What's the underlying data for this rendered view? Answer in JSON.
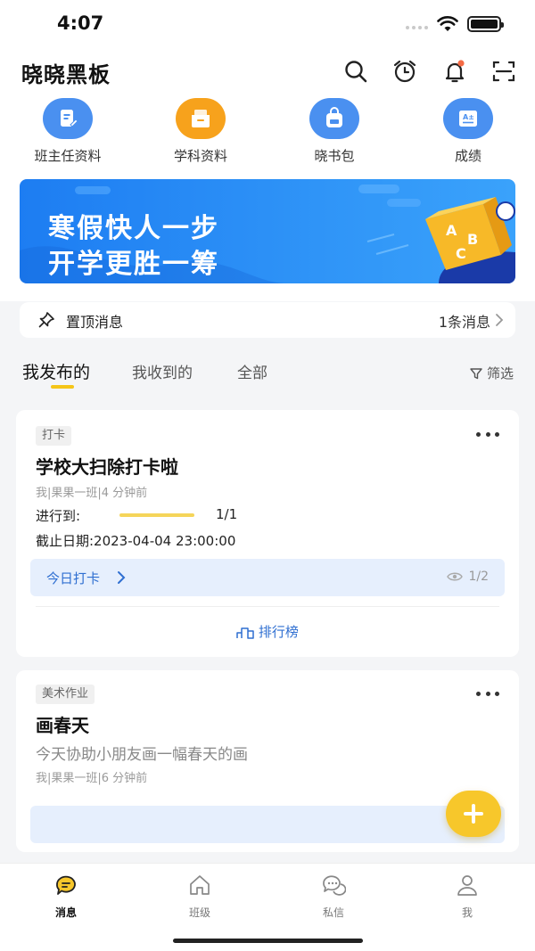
{
  "status_bar": {
    "time": "4:07"
  },
  "header": {
    "title": "晓晓黑板",
    "icons": [
      "search-icon",
      "alarm-clock-icon",
      "bell-icon",
      "scan-icon"
    ]
  },
  "quick_entries": [
    {
      "label": "班主任资料",
      "icon": "document-icon",
      "color": "#4a90f0"
    },
    {
      "label": "学科资料",
      "icon": "folder-icon",
      "color": "#f7a21c"
    },
    {
      "label": "晓书包",
      "icon": "backpack-icon",
      "color": "#4a90f0"
    },
    {
      "label": "成绩",
      "icon": "grade-icon",
      "color": "#4a90f0"
    }
  ],
  "banner": {
    "line1": "寒假快人一步",
    "line2": "开学更胜一筹",
    "cube_letters": [
      "A",
      "B",
      "C"
    ]
  },
  "pinned": {
    "label": "置顶消息",
    "count": "1条消息"
  },
  "tabs": {
    "items": [
      "我发布的",
      "我收到的",
      "全部"
    ],
    "active": 0,
    "filter": "筛选"
  },
  "cards": [
    {
      "tag": "打卡",
      "title": "学校大扫除打卡啦",
      "meta": "我|果果一班|4 分钟前",
      "progress_label": "进行到:",
      "progress": 1.0,
      "progress_text": "1/1",
      "deadline": "截止日期:2023-04-04 23:00:00",
      "checkin_label": "今日打卡",
      "views": "1/2",
      "rank_label": "排行榜"
    },
    {
      "tag": "美术作业",
      "title": "画春天",
      "desc": "今天协助小朋友画一幅春天的画",
      "meta": "我|果果一班|6 分钟前"
    }
  ],
  "bottom_nav": [
    {
      "label": "消息",
      "icon": "message-icon",
      "active": true
    },
    {
      "label": "班级",
      "icon": "home-icon",
      "active": false
    },
    {
      "label": "私信",
      "icon": "chat-icon",
      "active": false
    },
    {
      "label": "我",
      "icon": "user-icon",
      "active": false
    }
  ],
  "colors": {
    "accent": "#f5c518",
    "link": "#2f6fd1",
    "banner": "#2a8cf5"
  }
}
